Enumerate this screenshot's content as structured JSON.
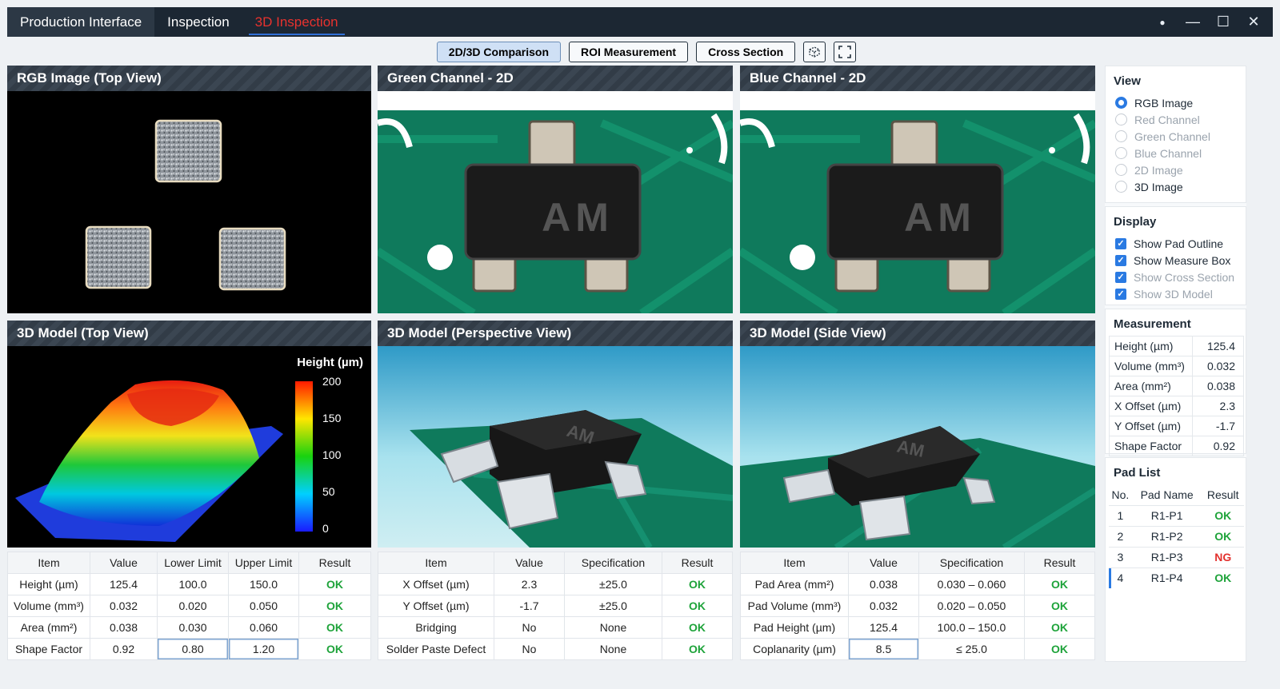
{
  "titlebar": {
    "tabs": [
      {
        "label": "Production Interface"
      },
      {
        "label": "Inspection"
      },
      {
        "label": "3D Inspection"
      }
    ]
  },
  "toolbar": {
    "compare_label": "2D/3D Comparison",
    "roi_label": "ROI Measurement",
    "cross_label": "Cross Section"
  },
  "panels": {
    "rgb_title": "RGB Image (Top View)",
    "green_title": "Green Channel - 2D",
    "blue_title": "Blue Channel - 2D",
    "model_top_title": "3D Model (Top View)",
    "model_persp_title": "3D Model (Perspective View)",
    "model_side_title": "3D Model (Side View)",
    "component_marking": "AM",
    "height_scale": {
      "title": "Height (µm)",
      "ticks": [
        "200",
        "150",
        "100",
        "50",
        "0"
      ]
    }
  },
  "table1": {
    "headers": [
      "Item",
      "Value",
      "Lower Limit",
      "Upper Limit",
      "Result"
    ],
    "rows": [
      [
        "Height (µm)",
        "125.4",
        "100.0",
        "150.0",
        "OK"
      ],
      [
        "Volume (mm³)",
        "0.032",
        "0.020",
        "0.050",
        "OK"
      ],
      [
        "Area (mm²)",
        "0.038",
        "0.030",
        "0.060",
        "OK"
      ],
      [
        "Shape Factor",
        "0.92",
        "0.80",
        "1.20",
        "OK"
      ]
    ]
  },
  "table2": {
    "headers": [
      "Item",
      "Value",
      "Specification",
      "Result"
    ],
    "rows": [
      [
        "X Offset (µm)",
        "2.3",
        "±25.0",
        "OK"
      ],
      [
        "Y Offset (µm)",
        "-1.7",
        "±25.0",
        "OK"
      ],
      [
        "Bridging",
        "No",
        "None",
        "OK"
      ],
      [
        "Solder Paste Defect",
        "No",
        "None",
        "OK"
      ]
    ]
  },
  "table3": {
    "headers": [
      "Item",
      "Value",
      "Specification",
      "Result"
    ],
    "rows": [
      [
        "Pad Area (mm²)",
        "0.038",
        "0.030 – 0.060",
        "OK"
      ],
      [
        "Pad Volume (mm³)",
        "0.032",
        "0.020 – 0.050",
        "OK"
      ],
      [
        "Pad Height (µm)",
        "125.4",
        "100.0 – 150.0",
        "OK"
      ],
      [
        "Coplanarity (µm)",
        "8.5",
        "≤ 25.0",
        "OK"
      ]
    ]
  },
  "sidebar": {
    "view_title": "View",
    "view_options": [
      {
        "label": "RGB Image",
        "selected": true
      },
      {
        "label": "Red Channel",
        "selected": false
      },
      {
        "label": "Green Channel",
        "selected": false
      },
      {
        "label": "Blue Channel",
        "selected": false
      },
      {
        "label": "2D Image",
        "selected": false
      },
      {
        "label": "3D Image",
        "selected": false
      }
    ],
    "display_title": "Display",
    "display_options": [
      {
        "label": "Show Pad Outline"
      },
      {
        "label": "Show Measure Box"
      },
      {
        "label": "Show Cross Section"
      },
      {
        "label": "Show 3D Model"
      }
    ],
    "measurement_title": "Measurement",
    "measurements": [
      [
        "Height (µm)",
        "125.4"
      ],
      [
        "Volume (mm³)",
        "0.032"
      ],
      [
        "Area (mm²)",
        "0.038"
      ],
      [
        "X Offset (µm)",
        "2.3"
      ],
      [
        "Y Offset (µm)",
        "-1.7"
      ],
      [
        "Shape Factor",
        "0.92"
      ]
    ],
    "padlist_title": "Pad List",
    "pad_headers": [
      "No.",
      "Pad Name",
      "Result"
    ],
    "pads": [
      [
        "1",
        "R1-P1",
        "OK"
      ],
      [
        "2",
        "R1-P2",
        "OK"
      ],
      [
        "3",
        "R1-P3",
        "NG"
      ],
      [
        "4",
        "R1-P4",
        "OK"
      ]
    ]
  },
  "colors": {
    "ok": "#1ea33a",
    "ng": "#e3312e",
    "accent": "#2a7ae2",
    "pcb": "#0f7a5c"
  }
}
